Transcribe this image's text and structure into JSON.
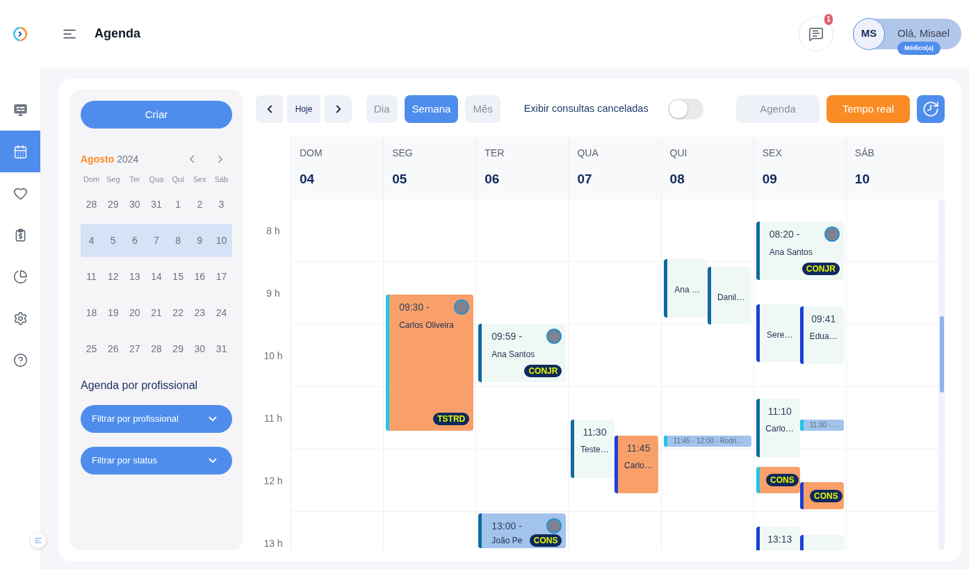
{
  "header": {
    "title": "Agenda",
    "notification_count": "1",
    "user": {
      "initials": "MS",
      "greeting": "Olá, Misael",
      "role": "Médico(a)"
    }
  },
  "sidebar": {
    "items": [
      {
        "selected": false
      },
      {
        "selected": true
      },
      {
        "selected": false
      },
      {
        "selected": false
      },
      {
        "selected": false
      },
      {
        "selected": false
      },
      {
        "selected": false
      }
    ]
  },
  "left_panel": {
    "create_button": "Criar",
    "mini_calendar": {
      "month": "Agosto",
      "year": "2024",
      "weekdays": [
        "Dom",
        "Seg",
        "Ter",
        "Qua",
        "Qui",
        "Sex",
        "Sáb"
      ],
      "weeks": [
        {
          "selected": false,
          "days": [
            "28",
            "29",
            "30",
            "31",
            "1",
            "2",
            "3"
          ]
        },
        {
          "selected": true,
          "days": [
            "4",
            "5",
            "6",
            "7",
            "8",
            "9",
            "10"
          ]
        },
        {
          "selected": false,
          "days": [
            "11",
            "12",
            "13",
            "14",
            "15",
            "16",
            "17"
          ]
        },
        {
          "selected": false,
          "days": [
            "18",
            "19",
            "20",
            "21",
            "22",
            "23",
            "24"
          ]
        },
        {
          "selected": false,
          "days": [
            "25",
            "26",
            "27",
            "28",
            "29",
            "30",
            "31"
          ]
        }
      ]
    },
    "section_title": "Agenda por profissional",
    "filters": [
      {
        "label": "Filtrar por profissional"
      },
      {
        "label": "Filtrar por status"
      }
    ]
  },
  "toolbar": {
    "today_button": "Hoje",
    "views": [
      {
        "label": "Dia",
        "selected": false
      },
      {
        "label": "Semana",
        "selected": true
      },
      {
        "label": "Mês",
        "selected": false
      }
    ],
    "cancelled_toggle": {
      "label": "Exibir consultas canceladas",
      "on": false
    },
    "buttons": [
      {
        "label": "Agenda",
        "kind": "plain"
      },
      {
        "label": "Tempo real",
        "kind": "accent"
      }
    ]
  },
  "calendar": {
    "hours": [
      "8 h",
      "9 h",
      "10 h",
      "11 h",
      "12 h",
      "13 h"
    ],
    "days": [
      {
        "weekday": "DOM",
        "date": "04"
      },
      {
        "weekday": "SEG",
        "date": "05",
        "events": [
          {
            "kind": "card",
            "time": "09:30 -",
            "name": "Carlos Oliveira",
            "tag": "TSTRD",
            "avatar": true,
            "color": "#f9a06a",
            "stripe": {
              "color": "#22c5eb"
            }
          }
        ]
      },
      {
        "weekday": "TER",
        "date": "06",
        "events": [
          {
            "kind": "card",
            "time": "09:59 -",
            "name": "Ana Santos",
            "tag": "CONJR",
            "avatar": true,
            "color": "#eff8f5",
            "stripe": {
              "color": "#0e6aa1"
            }
          },
          {
            "kind": "card",
            "time": "13:00 -",
            "name": "João Pe",
            "tag": "CONS",
            "avatar": true,
            "color": "#a2c3ec",
            "stripe": {
              "color": "#0e6aa1"
            }
          }
        ]
      },
      {
        "weekday": "QUA",
        "date": "07",
        "events": [
          {
            "kind": "card",
            "time": "11:30",
            "name": "Teste…",
            "avatar": false,
            "color": "#eff8f5",
            "stripe": {
              "color": "#0e6aa1"
            }
          },
          {
            "kind": "card",
            "time": "11:45",
            "name": "Carlo…",
            "avatar": false,
            "color": "#f9a06a",
            "stripe": {
              "color": "#1c3fd9"
            }
          }
        ]
      },
      {
        "weekday": "QUI",
        "date": "08",
        "events": [
          {
            "kind": "card",
            "name": "Ana …",
            "avatar": false,
            "color": "#eff8f5",
            "stripe": {
              "color": "#0e6aa1"
            }
          },
          {
            "kind": "card",
            "name": "Danil…",
            "avatar": false,
            "color": "#eff8f5",
            "stripe": {
              "color": "#0e6aa1"
            }
          },
          {
            "kind": "strip",
            "label": "11:45 - 12:00 - Rodri…",
            "color": "#a2c3ec",
            "stripe": {
              "color": "#22c5eb"
            }
          }
        ]
      },
      {
        "weekday": "SEX",
        "date": "09",
        "events": [
          {
            "kind": "card",
            "time": "08:20 -",
            "name": "Ana Santos",
            "tag": "CONJR",
            "avatar": true,
            "color": "#eff8f5",
            "stripe": {
              "color": "#0e6aa1"
            }
          },
          {
            "kind": "card",
            "name": "Sere…",
            "avatar": false,
            "color": "#eff8f5",
            "stripe": {
              "color": "#1c3fd9"
            }
          },
          {
            "kind": "card",
            "time": "09:41",
            "name": "Edua…",
            "avatar": false,
            "color": "#eff8f5",
            "stripe": {
              "color": "#1c3fd9"
            }
          },
          {
            "kind": "card",
            "time": "11:10",
            "name": "Carlo…",
            "avatar": false,
            "color": "#eff8f5",
            "stripe": {
              "color": "#0e6aa1"
            }
          },
          {
            "kind": "strip",
            "label": "11:30 - …",
            "color": "#a2c3ec",
            "stripe": {
              "color": "#22c5eb"
            }
          },
          {
            "kind": "card",
            "tag": "CONS",
            "avatar": false,
            "color": "#f9a06a",
            "stripe": {
              "color": "#22c5eb"
            }
          },
          {
            "kind": "card",
            "tag": "CONS",
            "avatar": false,
            "color": "#f9a06a",
            "stripe": {
              "color": "#1c3fd9"
            }
          },
          {
            "kind": "card",
            "time": "13:13",
            "avatar": false,
            "color": "#eff8f5",
            "stripe": {
              "color": "#1c3fd9"
            }
          },
          {
            "kind": "card",
            "avatar": false,
            "color": "#eff8f5",
            "stripe": {
              "color": "#1c3fd9"
            }
          }
        ]
      },
      {
        "weekday": "SÁB",
        "date": "10"
      }
    ]
  }
}
